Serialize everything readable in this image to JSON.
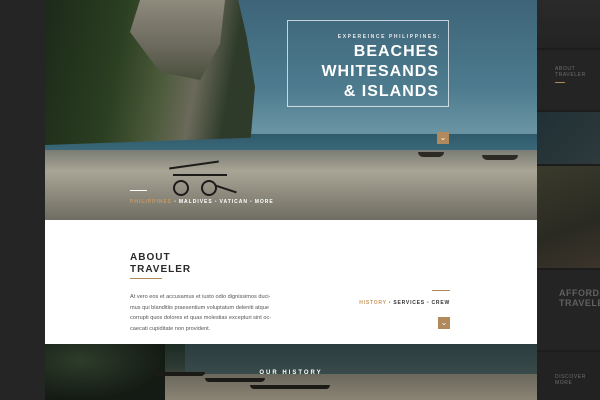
{
  "hero": {
    "eyebrow": "EXPEREINCE PHILIPPINES:",
    "title_line_1": "BEACHES",
    "title_line_2": "WHITESANDS",
    "title_line_3": "& ISLANDS",
    "down_icon": "chevron-down-icon",
    "breadcrumbs": [
      {
        "label": "PHILIPPINES",
        "active": true
      },
      {
        "label": "MALDIVES",
        "active": false
      },
      {
        "label": "VATICAN",
        "active": false
      },
      {
        "label": "MORE",
        "active": false
      }
    ],
    "separator": "•"
  },
  "about": {
    "title_line_1": "ABOUT",
    "title_line_2": "TRAVELER",
    "body": "At vero eos et accusamus et iusto odio dignissimos duci-mus qui blanditiis praesentium voluptatum deleniti atque corrupti quos dolores et quas molestias excepturi sint oc-caecati cupiditate non provident.",
    "tabs": [
      {
        "label": "HISTORY",
        "active": true
      },
      {
        "label": "SERVICES",
        "active": false
      },
      {
        "label": "CREW",
        "active": false
      }
    ],
    "separator": "•"
  },
  "history": {
    "title": "OUR HISTORY"
  },
  "side_panel": {
    "label_1_line_1": "ABOUT",
    "label_1_line_2": "TRAVELER",
    "label_2_line_1": "AFFORDA",
    "label_2_line_2": "TRAVELEX",
    "label_3_line_1": "DISCOVER",
    "label_3_line_2": "MORE"
  },
  "colors": {
    "accent": "#b08a5d",
    "accent_text": "#c89a64",
    "page_bg": "#1e1e1e",
    "content_bg": "#ffffff"
  }
}
